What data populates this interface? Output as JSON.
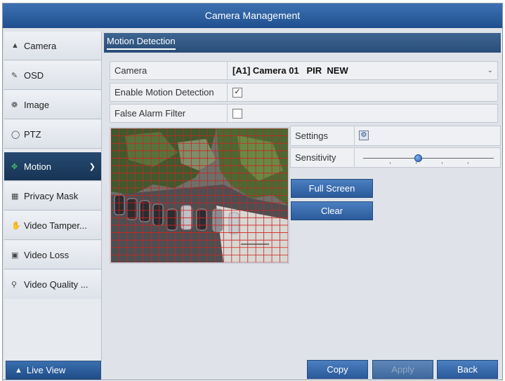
{
  "window": {
    "title": "Camera Management"
  },
  "sidebar": {
    "items": [
      {
        "label": "Camera",
        "icon": "camera-icon"
      },
      {
        "label": "OSD",
        "icon": "osd-icon"
      },
      {
        "label": "Image",
        "icon": "image-icon"
      },
      {
        "label": "PTZ",
        "icon": "ptz-icon"
      },
      {
        "label": "Motion",
        "icon": "motion-icon",
        "active": true
      },
      {
        "label": "Privacy Mask",
        "icon": "privacy-mask-icon"
      },
      {
        "label": "Video Tamper...",
        "icon": "video-tamper-icon"
      },
      {
        "label": "Video Loss",
        "icon": "video-loss-icon"
      },
      {
        "label": "Video Quality ...",
        "icon": "video-quality-icon"
      }
    ],
    "live_view": "Live View"
  },
  "main": {
    "tab": "Motion Detection",
    "fields": {
      "camera_label": "Camera",
      "camera_value": "[A1] Camera 01   PIR  NEW",
      "enable_label": "Enable Motion Detection",
      "enable_checked": true,
      "false_alarm_label": "False Alarm Filter",
      "false_alarm_checked": false
    },
    "settings_label": "Settings",
    "sensitivity_label": "Sensitivity",
    "sensitivity_level": 0.42,
    "full_screen_button": "Full Screen",
    "clear_button": "Clear"
  },
  "footer": {
    "copy": "Copy",
    "apply": "Apply",
    "back": "Back"
  },
  "colors": {
    "title_bar": "#2d5fa0",
    "active_item": "#1f3f63",
    "grid_line": "#d42020"
  }
}
